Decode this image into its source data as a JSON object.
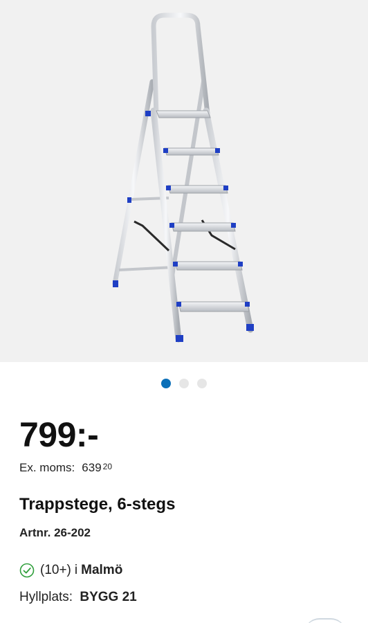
{
  "product_image": {
    "icon": "ladder-image",
    "accent_color": "#1f3fc4",
    "background_color": "#f1f1f1"
  },
  "carousel": {
    "count": 3,
    "active_index": 0,
    "active_color": "#0b6fb8"
  },
  "price": {
    "main": "799:-",
    "ex_moms_label": "Ex. moms:",
    "ex_moms_value": "639",
    "ex_moms_decimals": "20"
  },
  "product": {
    "title": "Trappstege, 6-stegs",
    "artnr_label": "Artnr.",
    "artnr_value": "26-202"
  },
  "stock": {
    "icon": "check-circle-icon",
    "status_color": "#2e9e3a",
    "quantity": "(10+)",
    "prefix": "i",
    "location": "Malmö"
  },
  "shelf": {
    "label": "Hyllplats:",
    "code": "BYGG 21"
  }
}
